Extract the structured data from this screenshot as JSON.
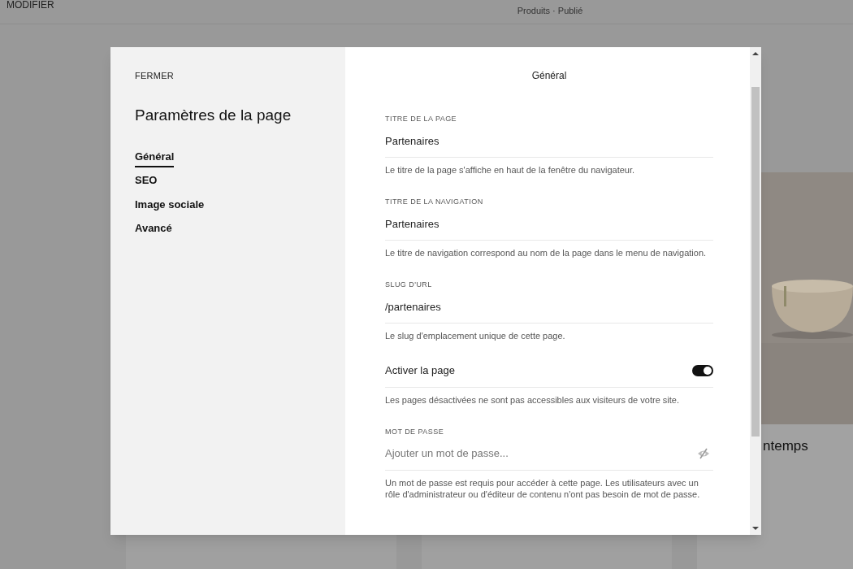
{
  "background": {
    "edit_label": "MODIFIER",
    "page_meta": "Produits · Publié",
    "card_caption": "ntemps"
  },
  "dialog": {
    "close": "FERMER",
    "title": "Paramètres de la page",
    "nav": [
      {
        "label": "Général",
        "selected": true
      },
      {
        "label": "SEO",
        "selected": false
      },
      {
        "label": "Image sociale",
        "selected": false
      },
      {
        "label": "Avancé",
        "selected": false
      }
    ],
    "section_title": "Général",
    "fields": [
      {
        "kind": "text",
        "label": "TITRE DE LA PAGE",
        "value": "Partenaires",
        "help": "Le titre de la page s'affiche en haut de la fenêtre du navigateur."
      },
      {
        "kind": "text",
        "label": "TITRE DE LA NAVIGATION",
        "value": "Partenaires",
        "help": "Le titre de navigation correspond au nom de la page dans le menu de navigation."
      },
      {
        "kind": "text",
        "label": "SLUG D'URL",
        "value": "/partenaires",
        "help": "Le slug d'emplacement unique de cette page."
      },
      {
        "kind": "toggle",
        "label": "Activer la page",
        "on": true,
        "help": "Les pages désactivées ne sont pas accessibles aux visiteurs de votre site."
      },
      {
        "kind": "password",
        "label": "MOT DE PASSE",
        "placeholder": "Ajouter un mot de passe...",
        "help": "Un mot de passe est requis pour accéder à cette page. Les utilisateurs avec un rôle d'administrateur ou d'éditeur de contenu n'ont pas besoin de mot de passe."
      }
    ]
  }
}
